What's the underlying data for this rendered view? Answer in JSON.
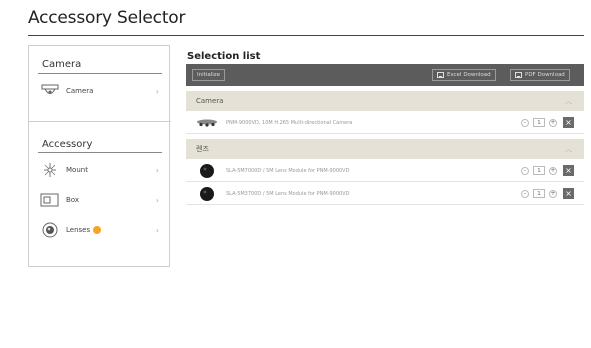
{
  "page": {
    "title": "Accessory Selector"
  },
  "left_panel": {
    "camera_heading": "Camera",
    "camera_items": [
      {
        "label": "Camera",
        "icon": "dome-camera-icon"
      }
    ],
    "accessory_heading": "Accessory",
    "accessory_items": [
      {
        "label": "Mount",
        "icon": "mount-icon"
      },
      {
        "label": "Box",
        "icon": "box-icon"
      },
      {
        "label": "Lenses",
        "icon": "lens-icon",
        "badge_color": "#f5a623"
      }
    ]
  },
  "selection_list": {
    "title": "Selection list",
    "toolbar": {
      "initialize_label": "Initialize",
      "excel_label": "Excel Download",
      "pdf_label": "PDF Download"
    },
    "groups": [
      {
        "label": "Camera",
        "items": [
          {
            "name": "PNM-9000VD, 10M H.265 Multi-directional Camera",
            "qty": "1"
          }
        ]
      },
      {
        "label": "렌즈",
        "items": [
          {
            "name": "SLA-5M7000D / 5M Lens Module for PNM-9000VD",
            "qty": "1"
          },
          {
            "name": "SLA-5M3700D / 5M Lens Module for PNM-9000VD",
            "qty": "1"
          }
        ]
      }
    ]
  }
}
